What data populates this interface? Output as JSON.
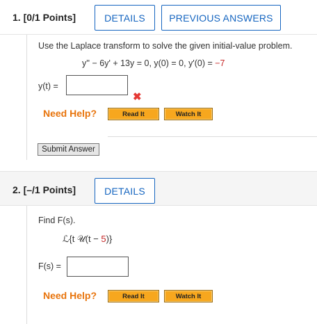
{
  "q1": {
    "number": "1.",
    "points": "[0/1 Points]",
    "details_label": "DETAILS",
    "prev_answers_label": "PREVIOUS ANSWERS",
    "prompt": "Use the Laplace transform to solve the given initial-value problem.",
    "equation": "y'' − 6y' + 13y = 0,  y(0) = 0,  y'(0) = ",
    "equation_value": "−7",
    "answer_label": "y(t) =",
    "answer_value": "",
    "incorrect_icon": "x-mark-icon",
    "need_help": "Need Help?",
    "read_it": "Read It",
    "watch_it": "Watch It",
    "submit_label": "Submit Answer"
  },
  "q2": {
    "number": "2.",
    "points": "[–/1 Points]",
    "details_label": "DETAILS",
    "prompt": "Find F(s).",
    "expression_prefix": "ℒ{t 𝒰(t − ",
    "expression_value": "5",
    "expression_suffix": ")}",
    "answer_label": "F(s) =",
    "answer_value": "",
    "need_help": "Need Help?",
    "read_it": "Read It",
    "watch_it": "Watch It"
  },
  "colors": {
    "link_blue": "#1565c0",
    "need_help_orange": "#e8740c",
    "help_button": "#f7a71e",
    "incorrect_red": "#e53935",
    "highlight_red": "#c62828"
  }
}
